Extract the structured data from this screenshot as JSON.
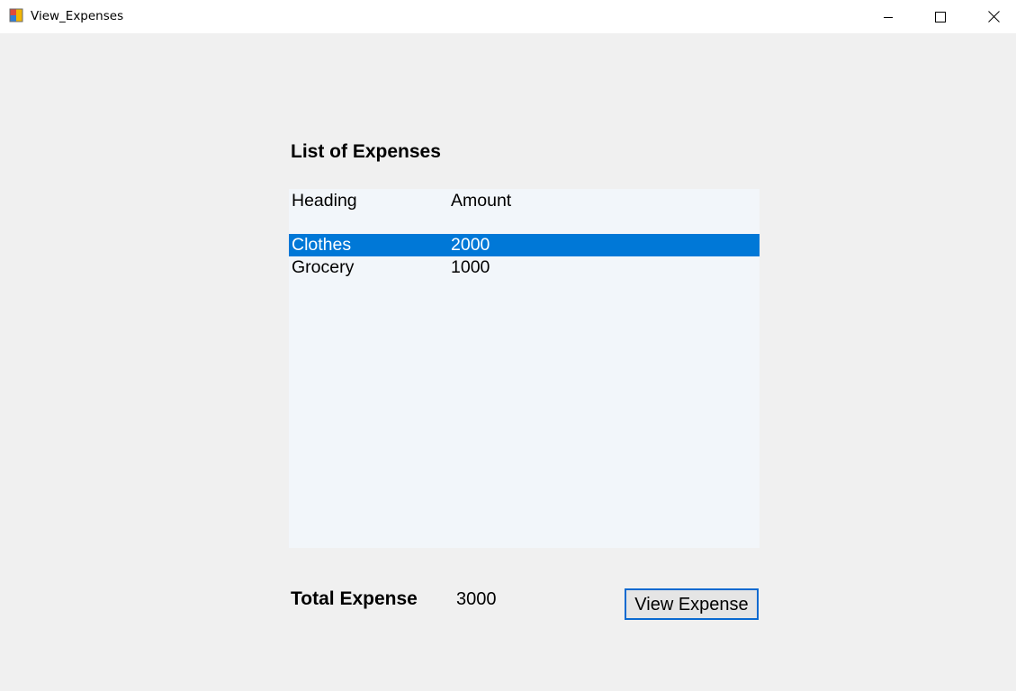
{
  "window": {
    "title": "View_Expenses",
    "icon": "winforms-app-icon",
    "controls": [
      "minimize-icon",
      "maximize-icon",
      "close-icon"
    ]
  },
  "main": {
    "list_title": "List of Expenses",
    "columns": [
      "Heading",
      "Amount"
    ],
    "rows": [
      {
        "heading": "Clothes",
        "amount": "2000",
        "selected": true
      },
      {
        "heading": "Grocery",
        "amount": "1000",
        "selected": false
      }
    ],
    "total_label": "Total Expense",
    "total_value": "3000",
    "view_button_label": "View Expense"
  },
  "colors": {
    "selection": "#0078d7",
    "listview_bg": "#f2f6fa",
    "button_border": "#0a6ad0",
    "window_bg": "#f0f0f0"
  }
}
